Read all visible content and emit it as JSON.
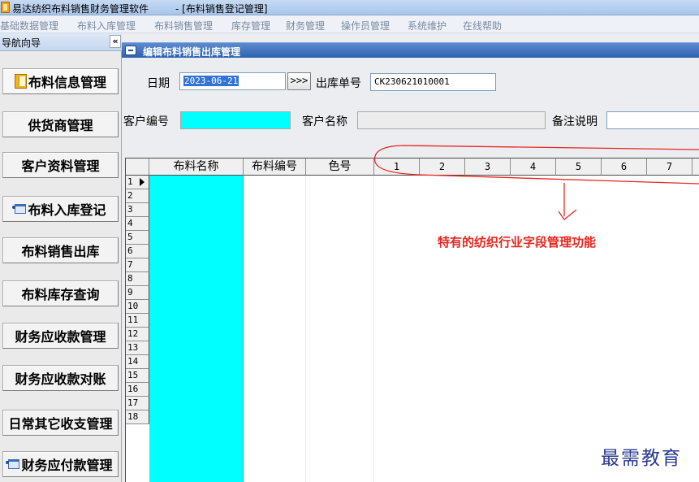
{
  "window": {
    "app_title": "易达纺织布料销售财务管理软件",
    "doc_title": "- [布料销售登记管理]"
  },
  "menu": [
    "基础数据管理",
    "布料入库管理",
    "布料销售管理",
    "库存管理",
    "财务管理",
    "操作员管理",
    "系统维护",
    "在线帮助"
  ],
  "sidebar": {
    "title": "导航向导",
    "collapse_label": "«",
    "items": [
      {
        "label": "布料信息管理",
        "icon": "book-icon"
      },
      {
        "label": "供货商管理"
      },
      {
        "label": "客户资料管理"
      },
      {
        "label": "布料入库登记",
        "icon": "window-icon"
      },
      {
        "label": "布料销售出库"
      },
      {
        "label": "布料库存查询"
      },
      {
        "label": "财务应收款管理"
      },
      {
        "label": "财务应收款对账"
      },
      {
        "label": "日常其它收支管理"
      },
      {
        "label": "财务应付款管理",
        "icon": "window-icon"
      }
    ]
  },
  "panel": {
    "title": "编辑布料销售出库管理"
  },
  "form": {
    "date_label": "日期",
    "date_value": "2023-06-21",
    "go_label": ">>>",
    "order_label": "出库单号",
    "order_value": "CK230621010001",
    "customer_id_label": "客户编号",
    "customer_id_value": "",
    "customer_name_label": "客户名称",
    "customer_name_value": "",
    "remark_label": "备注说明",
    "remark_value": ""
  },
  "grid": {
    "columns": [
      "布料名称",
      "布料编号",
      "色号",
      "1",
      "2",
      "3",
      "4",
      "5",
      "6",
      "7"
    ],
    "row_numbers": [
      "1",
      "2",
      "3",
      "4",
      "5",
      "6",
      "7",
      "8",
      "9",
      "10",
      "11",
      "12",
      "13",
      "14",
      "15",
      "16",
      "17",
      "18"
    ],
    "current_row": "1"
  },
  "annotation": "特有的纺织行业字段管理功能",
  "watermark": "最需教育",
  "colors": {
    "annotation": "#e8261f",
    "name_column": "#00ffff",
    "panel_header": "#2d61b0"
  }
}
